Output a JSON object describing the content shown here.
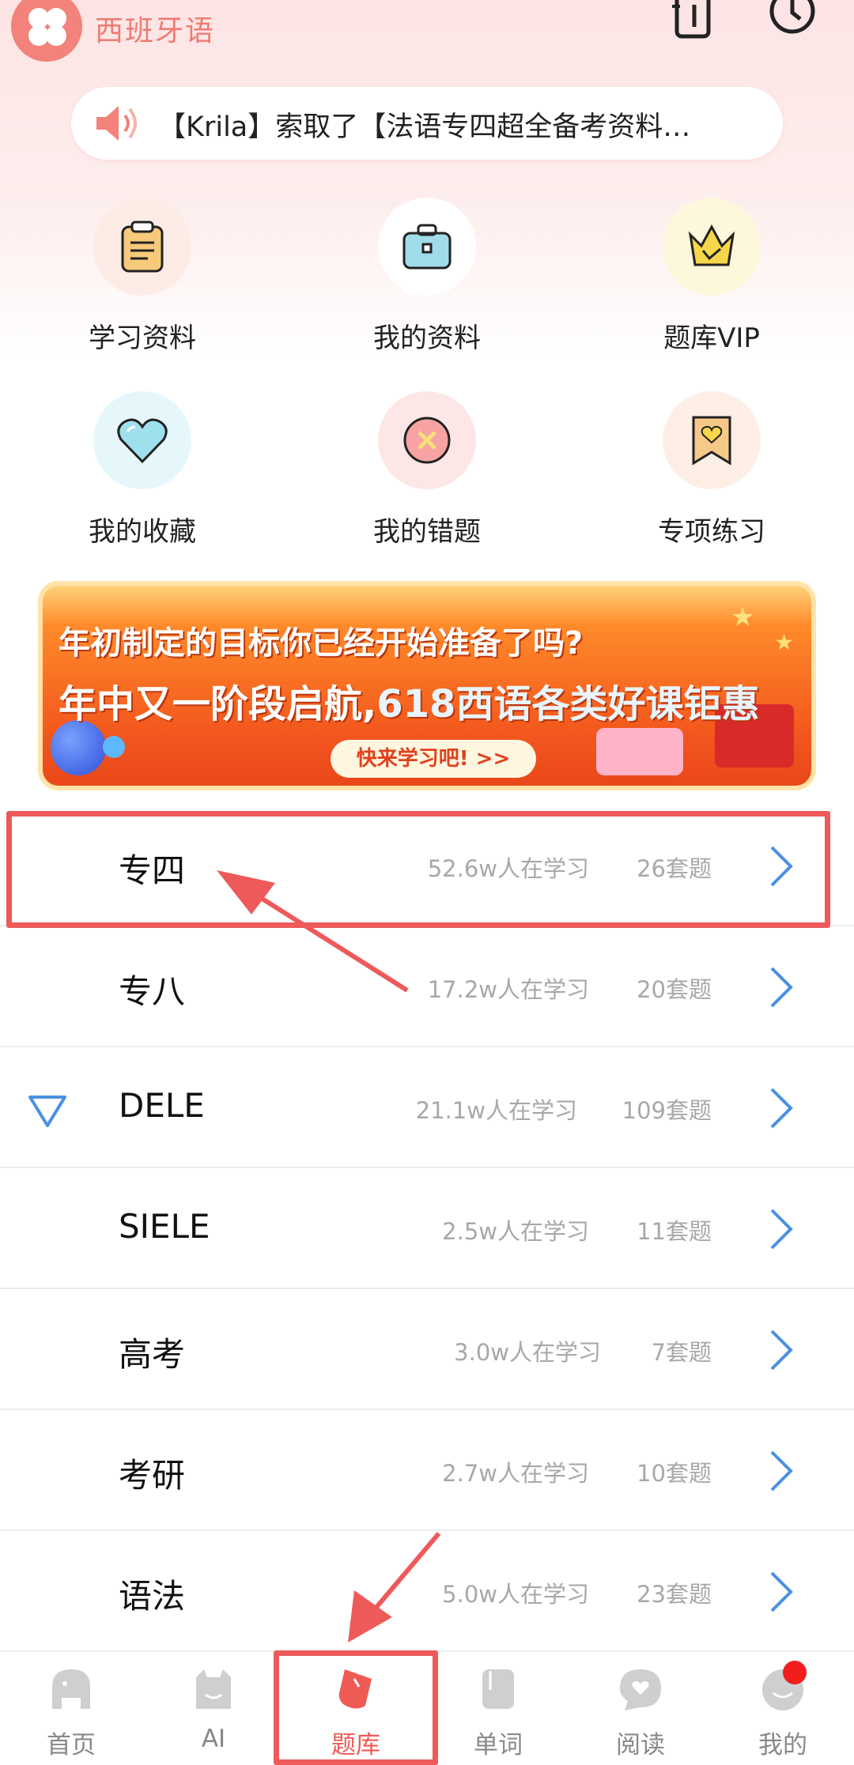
{
  "app": {
    "title": "西班牙语",
    "accent_color": "#ef7b73",
    "header_icons": [
      "notebook-icon",
      "clock-icon"
    ]
  },
  "notice": {
    "icon": "speaker-icon",
    "text": "【Krila】索取了【法语专四超全备考资料…"
  },
  "quick_grid": [
    {
      "label": "学习资料",
      "icon": "clipboard-icon"
    },
    {
      "label": "我的资料",
      "icon": "briefcase-icon"
    },
    {
      "label": "题库VIP",
      "icon": "crown-icon"
    },
    {
      "label": "我的收藏",
      "icon": "heart-icon"
    },
    {
      "label": "我的错题",
      "icon": "cross-circle-icon"
    },
    {
      "label": "专项练习",
      "icon": "bookmark-heart-icon"
    }
  ],
  "banner": {
    "line1": "年初制定的目标你已经开始准备了吗?",
    "line2_prefix": "年中又一阶段启航,",
    "line2_highlight": "618西语各类好课钜惠",
    "cta": "快来学习吧! >>"
  },
  "exam_list": [
    {
      "name": "专四",
      "learners": "52.6w人在学习",
      "sets": "26套题",
      "highlighted": true
    },
    {
      "name": "专八",
      "learners": "17.2w人在学习",
      "sets": "20套题"
    },
    {
      "name": "DELE",
      "learners": "21.1w人在学习",
      "sets": "109套题",
      "marker": "triangle-down-icon"
    },
    {
      "name": "SIELE",
      "learners": "2.5w人在学习",
      "sets": "11套题"
    },
    {
      "name": "高考",
      "learners": "3.0w人在学习",
      "sets": "7套题"
    },
    {
      "name": "考研",
      "learners": "2.7w人在学习",
      "sets": "10套题"
    },
    {
      "name": "语法",
      "learners": "5.0w人在学习",
      "sets": "23套题"
    }
  ],
  "bottom_nav": [
    {
      "label": "首页",
      "icon": "elephant-icon"
    },
    {
      "label": "AI",
      "icon": "ai-cat-icon"
    },
    {
      "label": "题库",
      "icon": "eraser-icon",
      "active": true
    },
    {
      "label": "单词",
      "icon": "book-icon"
    },
    {
      "label": "阅读",
      "icon": "chat-bubble-icon"
    },
    {
      "label": "我的",
      "icon": "smile-icon",
      "badge": "red-dot"
    }
  ],
  "colors": {
    "highlight": "#ee5a5a",
    "chevron": "#4a90e2",
    "muted_text": "#a8a8a8",
    "active_nav": "#ef5a55"
  }
}
